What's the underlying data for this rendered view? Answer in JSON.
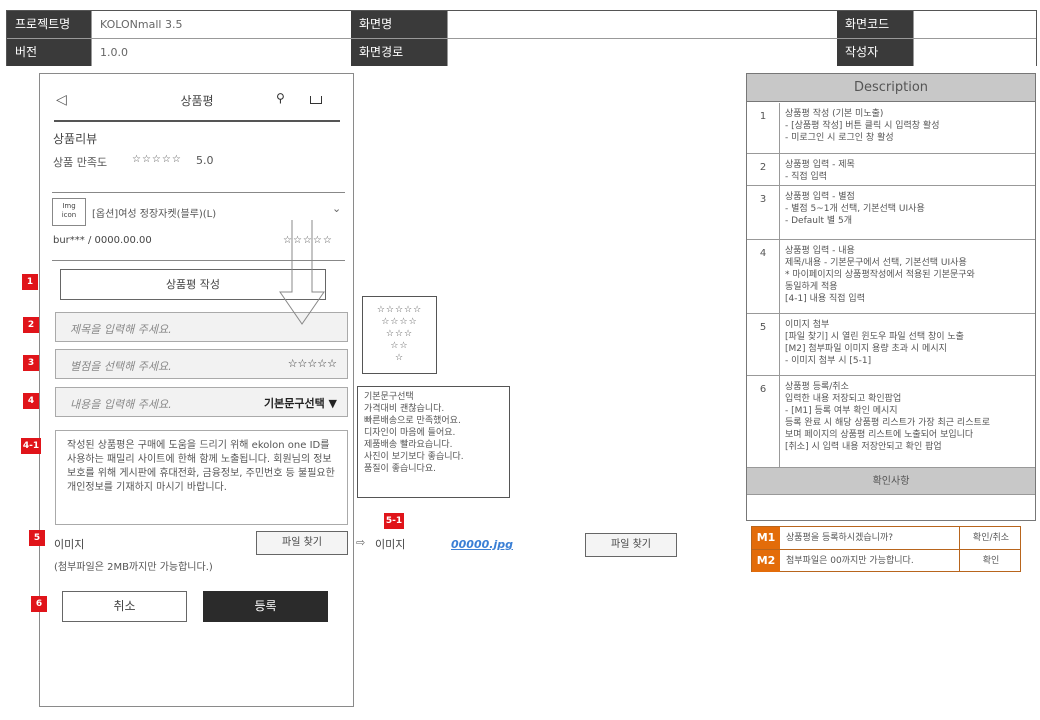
{
  "header": {
    "project_label": "프로젝트명",
    "project_value": "KOLONmall 3.5",
    "version_label": "버전",
    "version_value": "1.0.0",
    "screen_name_label": "화면명",
    "screen_name_value": "",
    "screen_path_label": "화면경로",
    "screen_path_value": "",
    "screen_code_label": "화면코드",
    "screen_code_value": "",
    "author_label": "작성자",
    "author_value": ""
  },
  "appbar": {
    "back_icon": "◁",
    "title": "상품평",
    "search_icon": "⚲"
  },
  "product": {
    "section_title": "상품리뷰",
    "rating_label": "상품 만족도",
    "rating_stars": "☆☆☆☆☆",
    "rating_value": "5.0",
    "image_placeholder": "Img icon",
    "option_title": "[옵션]여성 정장자켓(블루)(L)",
    "reviewer": "bur*** / 0000.00.00",
    "reviewer_stars": "☆☆☆☆☆"
  },
  "form": {
    "write_button": "상품평 작성",
    "title_placeholder": "제목을 입력해 주세요.",
    "rating_placeholder": "별점을 선택해 주세요.",
    "rating_stars": "☆☆☆☆☆",
    "content_placeholder": "내용을 입력해 주세요.",
    "template_select": "기본문구선택 ▼",
    "notice": "작성된 상품평은 구매에 도움을 드리기 위해 ekolon one ID를 사용하는 패밀리 사이트에 한해 함께 노출됩니다. 회원님의 정보보호를 위해 게시판에 휴대전화, 금융정보, 주민번호 등 불필요한 개인정보를 기재하지 마시기 바랍니다.",
    "image_label": "이미지",
    "image_hint": "(첨부파일은 2MB까지만 가능합니다.)",
    "file_button": "파일 찾기",
    "cancel_button": "취소",
    "submit_button": "등록"
  },
  "badges": {
    "b1": "1",
    "b2": "2",
    "b3": "3",
    "b4": "4",
    "b41": "4-1",
    "b5": "5",
    "b51": "5-1",
    "b6": "6"
  },
  "star_popup": {
    "line1": "☆☆☆☆☆",
    "line2": "☆☆☆☆",
    "line3": "☆☆☆",
    "line4": "☆☆",
    "line5": "☆"
  },
  "text_popup": {
    "lines": [
      "기본문구선택",
      "가격대비 괜찮습니다.",
      "빠른배송으로 만족했어요.",
      "디자인이 마음에 들어요.",
      "제품배송 빨라요습니다.",
      "사진이 보기보다 좋습니다.",
      "품질이 좋습니다요."
    ]
  },
  "image_preview": {
    "label": "이미지",
    "file_name": "00000.jpg",
    "file_button": "파일 찾기"
  },
  "description": {
    "title": "Description",
    "items": [
      {
        "num": "1",
        "lines": [
          "상품평 작성 (기본 미노출)",
          "- [상품평 작성] 버튼 클릭 시 입력창 활성",
          "- 미로그인 시 로그인 창 활성"
        ]
      },
      {
        "num": "2",
        "lines": [
          "상품평 입력 - 제목",
          "- 직접 입력"
        ]
      },
      {
        "num": "3",
        "lines": [
          "상품평 입력 - 별점",
          "- 별점 5~1개 선택, 기본선택 UI사용",
          "- Default 별 5개"
        ]
      },
      {
        "num": "4",
        "lines": [
          "상품평 입력 - 내용",
          "제목/내용 - 기본문구에서 선택, 기본선택 UI사용",
          "* 마이페이지의 상품평작성에서 적용된 기본문구와",
          "동일하게 적용",
          "[4-1] 내용 직접 입력"
        ]
      },
      {
        "num": "5",
        "lines": [
          "이미지 첨부",
          "[파일 찾기] 시 열린 윈도우 파일 선택 창이 노출",
          "[M2] 첨부파일 이미지 용량 초과 시 메시지",
          "- 이미지 첨부 시 [5-1]"
        ]
      },
      {
        "num": "6",
        "lines": [
          "상품평 등록/취소",
          "입력한 내용 저장되고 확인팝업",
          "- [M1] 등록 여부 확인 메시지",
          "등록 완료 시 해당 상품평 리스트가 가장 최근 리스트로",
          "보며 페이지의 상품평 리스트에 노출되어 보입니다",
          "[취소] 시 입력 내용 저장안되고 확인 팝업"
        ]
      }
    ],
    "sub_title": "확인사항"
  },
  "messages": [
    {
      "code": "M1",
      "text": "상품평을 등록하시겠습니까?",
      "action": "확인/취소"
    },
    {
      "code": "M2",
      "text": "첨부파일은 00까지만 가능합니다.",
      "action": "확인"
    }
  ]
}
